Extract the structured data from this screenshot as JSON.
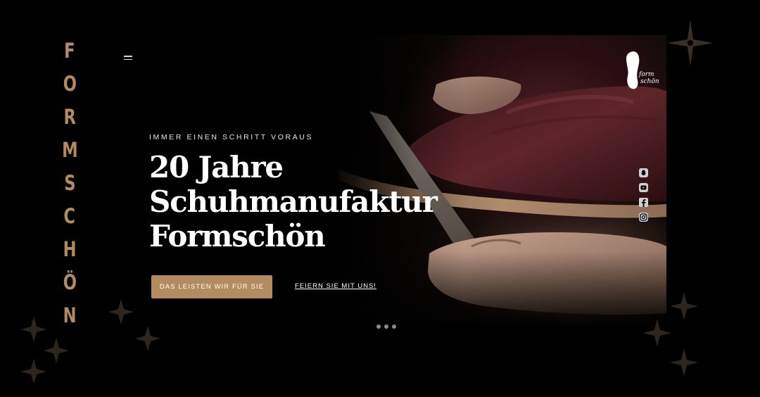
{
  "brand": {
    "vertical_letters": [
      "F",
      "O",
      "R",
      "M",
      "S",
      "C",
      "H",
      "Ö",
      "N"
    ],
    "color": "#b48a5f",
    "logo_text_top": "form",
    "logo_text_bottom": "schön"
  },
  "nav": {
    "menu_icon": "hamburger-icon"
  },
  "hero": {
    "kicker": "IMMER EINEN SCHRITT VORAUS",
    "headline_lines": [
      "20 Jahre",
      "Schuhmanufaktur",
      "Formschön"
    ],
    "primary_button": "DAS LEISTEN WIR FÜR SIE",
    "secondary_link": "FEIERN SIE MIT UNS!",
    "slider_dots": 3
  },
  "social": [
    {
      "name": "snapchat-icon"
    },
    {
      "name": "youtube-icon"
    },
    {
      "name": "facebook-icon"
    },
    {
      "name": "instagram-icon"
    }
  ],
  "colors": {
    "accent": "#b48a5f",
    "background": "#000000",
    "ornament": "#3a2f24"
  }
}
